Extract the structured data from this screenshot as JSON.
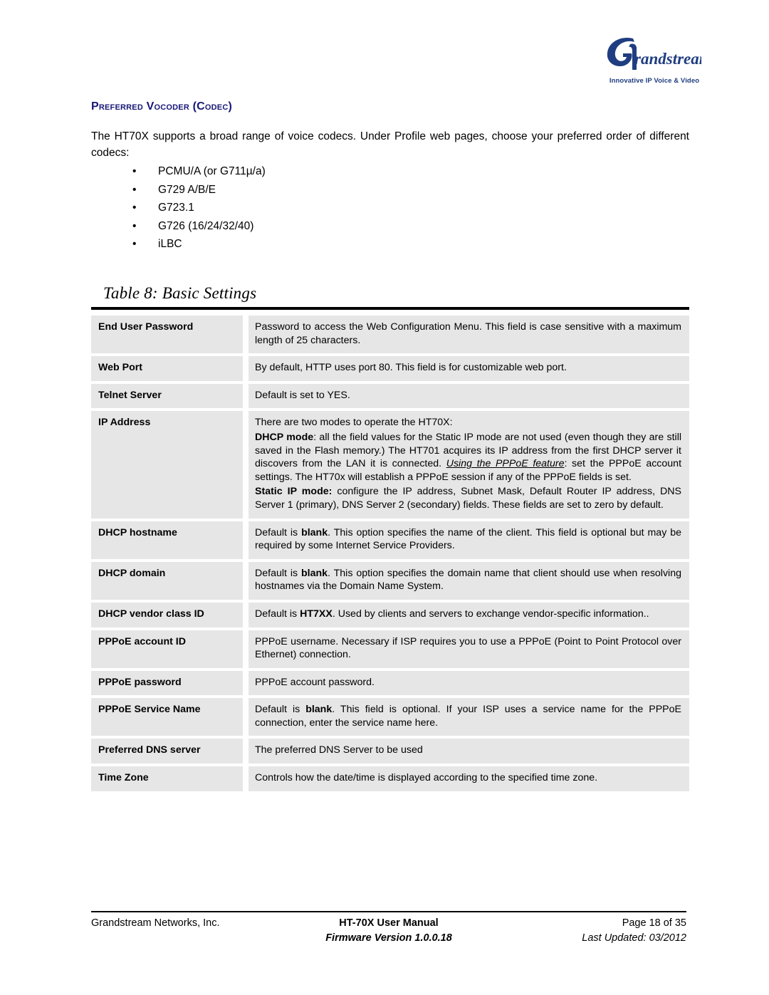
{
  "logo": {
    "brand": "Grandstream",
    "tagline": "Innovative IP Voice & Video",
    "color": "#1f3d80"
  },
  "section": {
    "heading": "Preferred Vocoder (Codec)",
    "heading_color": "#181878",
    "intro": "The HT70X supports a broad range of voice codecs.  Under Profile web pages, choose your preferred order of different codecs:",
    "bullet_glyph": "•",
    "codecs": [
      "PCMU/A (or G711µ/a)",
      "G729 A/B/E",
      "G723.1",
      "G726 (16/24/32/40)",
      "iLBC"
    ]
  },
  "table": {
    "caption": "Table 8:  Basic Settings",
    "rows": [
      {
        "key": "End User Password",
        "value": "Password to access the Web Configuration Menu. This field is case sensitive with a maximum length of 25 characters."
      },
      {
        "key": "Web Port",
        "value": "By default, HTTP uses port 80.  This field is for customizable web port."
      },
      {
        "key": "Telnet Server",
        "value": "Default is set to YES."
      },
      {
        "key": "IP Address",
        "value_parts": {
          "line1": "There are two modes to operate the HT70X:",
          "dhcp_label": "DHCP mode",
          "dhcp_text_a": ": all the field values for the Static IP mode are not used (even though they are still saved in the Flash memory.) The HT701 acquires its IP address from the first DHCP server it discovers from the LAN it is connected.  ",
          "pppoe_emphasis": "Using the PPPoE feature",
          "dhcp_text_b": ": set the PPPoE account settings. The HT70x will establish a PPPoE session if any of the PPPoE fields is set.",
          "static_label": "Static IP mode:",
          "static_text": "  configure the IP address, Subnet Mask, Default Router IP address, DNS Server 1 (primary), DNS Server 2 (secondary) fields. These fields are set to zero by default."
        }
      },
      {
        "key": "DHCP hostname",
        "value_parts": {
          "pre": "Default is ",
          "bold": "blank",
          "post": ". This option specifies the name of the client. This field is optional but may be required by some Internet Service Providers."
        }
      },
      {
        "key": "DHCP domain",
        "value_parts": {
          "pre": "Default is  ",
          "bold": "blank",
          "post": ". This option specifies the domain name that client should use when resolving hostnames via the Domain Name System."
        }
      },
      {
        "key": "DHCP vendor class ID",
        "value_parts": {
          "pre": "Default is ",
          "bold": "HT7XX",
          "post": ". Used by clients and servers to exchange vendor-specific information.."
        }
      },
      {
        "key": "PPPoE account ID",
        "value": "PPPoE username. Necessary if ISP requires you to use a PPPoE (Point to Point Protocol over Ethernet) connection."
      },
      {
        "key": "PPPoE password",
        "value": "PPPoE account password."
      },
      {
        "key": "PPPoE Service Name",
        "value_parts": {
          "pre": "Default is ",
          "bold": "blank",
          "post": ". This field is optional. If your ISP uses a service name for the PPPoE connection, enter the service name here."
        }
      },
      {
        "key": "Preferred DNS server",
        "value": "The preferred  DNS Server to be used"
      },
      {
        "key": "Time Zone",
        "value": "Controls how the date/time is displayed according to the specified time zone."
      }
    ]
  },
  "footer": {
    "left": "Grandstream Networks, Inc.",
    "center_line1": "HT-70X User Manual",
    "center_line2": "Firmware Version 1.0.0.18",
    "right_line1": "Page 18 of 35",
    "right_line2": "Last Updated: 03/2012"
  }
}
